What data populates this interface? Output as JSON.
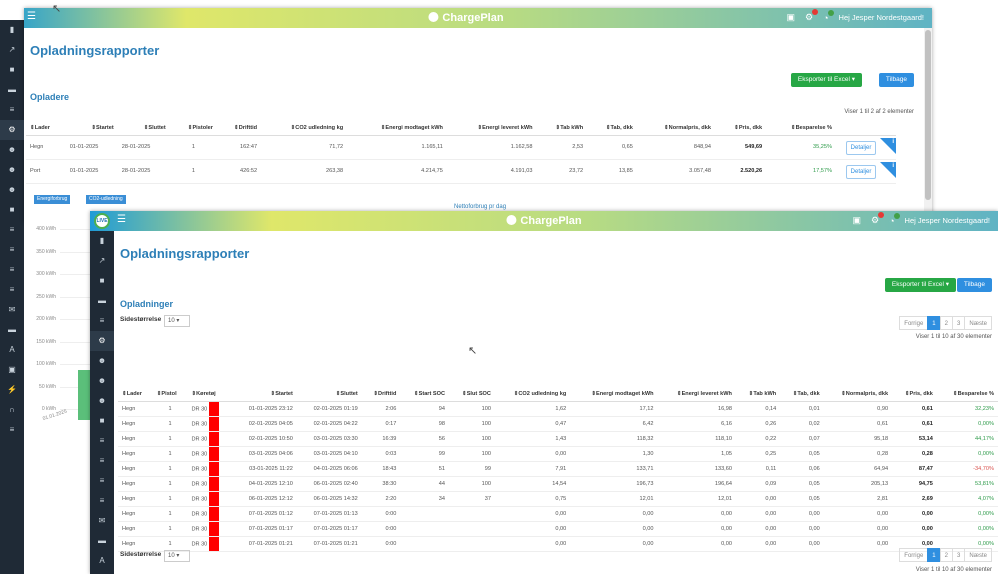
{
  "app": {
    "logo_text": "LIVE",
    "menu_icon": "hamburger-icon",
    "brand_name": "ChargePlan",
    "user_greeting": "Hej Jesper Nordestgaard!",
    "accent": "#2d7fb7",
    "sidebar_bg": "#1f2a36"
  },
  "win1": {
    "title": "Opladningsrapporter",
    "export_button": "Eksporter til Excel",
    "back_button": "Tilbage",
    "section": "Opladere",
    "info": "Viser 1 til 2 af 2 elementer",
    "columns": [
      "Lader",
      "Startet",
      "Sluttet",
      "Pistoler",
      "Drifttid",
      "CO2 udledning kg",
      "Energi modtaget kWh",
      "Energi leveret kWh",
      "Tab kWh",
      "Tab, dkk",
      "Normalpris, dkk",
      "Pris, dkk",
      "Besparelse %"
    ],
    "rows": [
      [
        "Hegn",
        "01-01-2025",
        "28-01-2025",
        "1",
        "162:47",
        "71,72",
        "1.165,11",
        "1.162,58",
        "2,53",
        "0,65",
        "848,94",
        "549,69",
        "35,25%"
      ],
      [
        "Port",
        "01-01-2025",
        "28-01-2025",
        "1",
        "426:52",
        "263,38",
        "4.214,75",
        "4.191,03",
        "23,72",
        "13,85",
        "3.057,48",
        "2.520,26",
        "17,57%"
      ]
    ],
    "detail_button": "Detaljer",
    "chips": [
      "Energiforbrug",
      "CO2-udledning"
    ],
    "chart_title": "Nettoforbrug pr dag",
    "y_ticks": [
      "400 kWh",
      "350 kWh",
      "300 kWh",
      "250 kWh",
      "200 kWh",
      "150 kWh",
      "100 kWh",
      "50 kWh",
      "0 kWh"
    ],
    "x_tick": "01.01.2025"
  },
  "win2": {
    "title": "Opladningsrapporter",
    "export_button": "Eksporter til Excel",
    "back_button": "Tilbage",
    "section": "Opladninger",
    "page_size_label": "Sidestørrelse",
    "page_size_value": "10",
    "pager": [
      "Forrige",
      "1",
      "2",
      "3",
      "Næste"
    ],
    "info": "Viser 1 til 10 af 30 elementer",
    "columns": [
      "Lader",
      "Pistol",
      "Køretøj",
      "Startet",
      "Sluttet",
      "Drifttid",
      "Start SOC",
      "Slut SOC",
      "CO2 udledning kg",
      "Energi modtaget kWh",
      "Energi leveret kWh",
      "Tab kWh",
      "Tab, dkk",
      "Normalpris, dkk",
      "Pris, dkk",
      "Besparelse %"
    ],
    "rows": [
      [
        "Hegn",
        "1",
        "DR 30",
        "01-01-2025 23:12",
        "02-01-2025 01:19",
        "2:06",
        "94",
        "100",
        "1,62",
        "17,12",
        "16,98",
        "0,14",
        "0,01",
        "0,90",
        "0,61",
        "32,23%"
      ],
      [
        "Hegn",
        "1",
        "DR 30",
        "02-01-2025 04:05",
        "02-01-2025 04:22",
        "0:17",
        "98",
        "100",
        "0,47",
        "6,42",
        "6,16",
        "0,26",
        "0,02",
        "0,61",
        "0,61",
        "0,00%"
      ],
      [
        "Hegn",
        "1",
        "DR 30",
        "02-01-2025 10:50",
        "03-01-2025 03:30",
        "16:39",
        "56",
        "100",
        "1,43",
        "118,32",
        "118,10",
        "0,22",
        "0,07",
        "95,18",
        "53,14",
        "44,17%"
      ],
      [
        "Hegn",
        "1",
        "DR 30",
        "03-01-2025 04:06",
        "03-01-2025 04:10",
        "0:03",
        "99",
        "100",
        "0,00",
        "1,30",
        "1,05",
        "0,25",
        "0,05",
        "0,28",
        "0,28",
        "0,00%"
      ],
      [
        "Hegn",
        "1",
        "DR 30",
        "03-01-2025 11:22",
        "04-01-2025 06:06",
        "18:43",
        "51",
        "99",
        "7,91",
        "133,71",
        "133,60",
        "0,11",
        "0,06",
        "64,94",
        "87,47",
        "-34,70%"
      ],
      [
        "Hegn",
        "1",
        "DR 30",
        "04-01-2025 12:10",
        "06-01-2025 02:40",
        "38:30",
        "44",
        "100",
        "14,54",
        "196,73",
        "196,64",
        "0,09",
        "0,05",
        "205,13",
        "94,75",
        "53,81%"
      ],
      [
        "Hegn",
        "1",
        "DR 30",
        "06-01-2025 12:12",
        "06-01-2025 14:32",
        "2:20",
        "34",
        "37",
        "0,75",
        "12,01",
        "12,01",
        "0,00",
        "0,05",
        "2,81",
        "2,69",
        "4,07%"
      ],
      [
        "Hegn",
        "1",
        "DR 30",
        "07-01-2025 01:12",
        "07-01-2025 01:13",
        "0:00",
        "",
        "",
        "0,00",
        "0,00",
        "0,00",
        "0,00",
        "0,00",
        "0,00",
        "0,00",
        "0,00%"
      ],
      [
        "Hegn",
        "1",
        "DR 30",
        "07-01-2025 01:17",
        "07-01-2025 01:17",
        "0:00",
        "",
        "",
        "0,00",
        "0,00",
        "0,00",
        "0,00",
        "0,00",
        "0,00",
        "0,00",
        "0,00%"
      ],
      [
        "Hegn",
        "1",
        "DR 30",
        "07-01-2025 01:21",
        "07-01-2025 01:21",
        "0:00",
        "",
        "",
        "0,00",
        "0,00",
        "0,00",
        "0,00",
        "0,00",
        "0,00",
        "0,00",
        "0,00%"
      ]
    ]
  }
}
